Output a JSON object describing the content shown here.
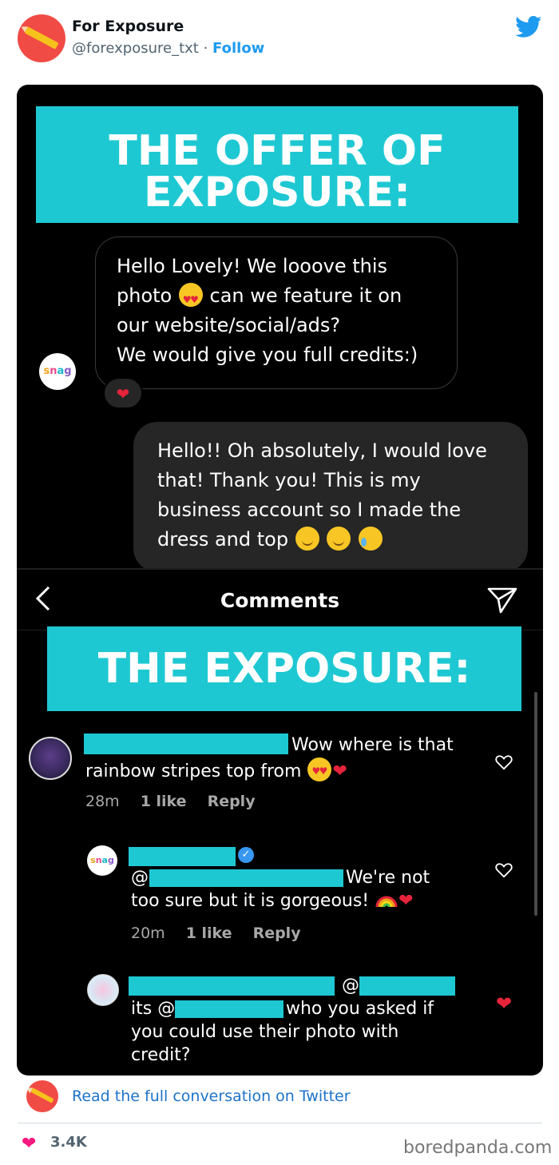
{
  "tweet": {
    "author": "For Exposure",
    "handle": "@forexposure_txt",
    "separator": "·",
    "follow_label": "Follow",
    "read_more": "Read the full conversation on Twitter",
    "likes": "3.4K"
  },
  "screenshot": {
    "banner_top": [
      "THE OFFER OF",
      "EXPOSURE:"
    ],
    "banner_bottom": "THE EXPOSURE:",
    "dm_received": {
      "line1": "Hello Lovely! We looove this",
      "line2a": "photo",
      "line2b": "can we feature it on",
      "line3": "our website/social/ads?",
      "line4": "We would give you full credits:)"
    },
    "dm_sent": {
      "line1": "Hello!! Oh absolutely, I would love",
      "line2": "that! Thank you! This is my",
      "line3": "business account so I made the",
      "line4": "dress and top"
    },
    "comments_title": "Comments",
    "comments": [
      {
        "text1": "Wow where is that",
        "text2": "rainbow stripes top from",
        "time": "28m",
        "likes": "1 like",
        "reply": "Reply"
      },
      {
        "text1a": "@",
        "text1b": "We're not",
        "text2": "too sure but it is gorgeous!",
        "time": "20m",
        "likes": "1 like",
        "reply": "Reply"
      },
      {
        "at": "@",
        "text1a": "its @",
        "text1b": "who you asked if",
        "text2": "you could use their photo with",
        "text3": "credit?"
      }
    ]
  },
  "watermark": "boredpanda.com",
  "colors": {
    "banner": "#1ec8d2",
    "twitter_blue": "#1d9bf0",
    "heart_red": "#e5243b",
    "avatar_red": "#f04b45"
  },
  "icons": [
    "twitter-bird-icon",
    "back-arrow-icon",
    "send-icon",
    "heart-outline-icon",
    "heart-filled-icon",
    "verified-badge-icon"
  ]
}
